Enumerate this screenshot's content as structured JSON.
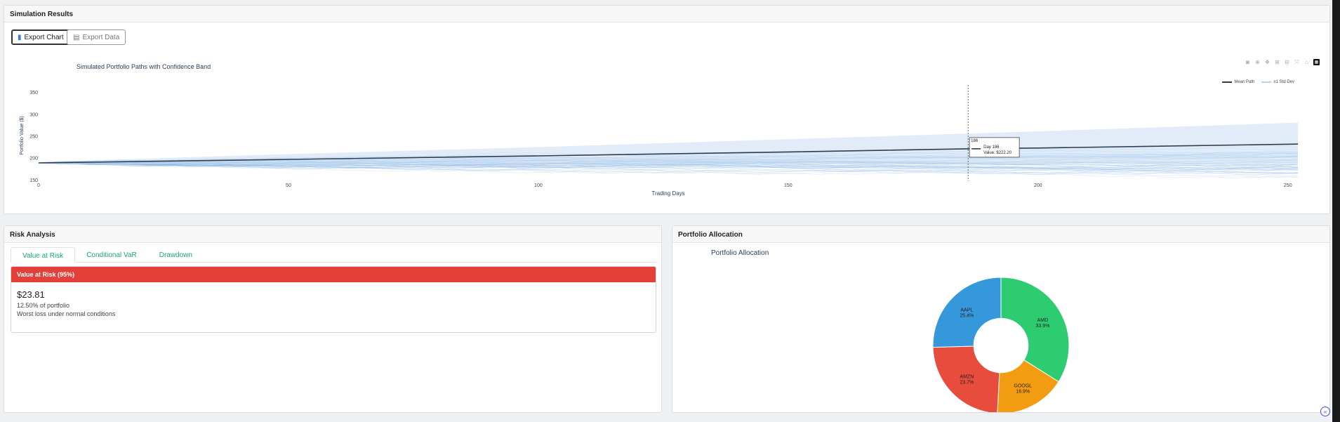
{
  "simulation": {
    "header": "Simulation Results",
    "export_chart_label": "Export Chart",
    "export_data_label": "Export Data",
    "chart_title": "Simulated Portfolio Paths with Confidence Band",
    "legend_mean": "Mean Path",
    "legend_band": "±1 Std Dev",
    "tooltip_header": "186",
    "tooltip_day": "Day 186",
    "tooltip_value": "Value: $222.20",
    "toolbar_icons": [
      "camera-icon",
      "zoom-icon",
      "pan-icon",
      "zoom-in-icon",
      "zoom-out-icon",
      "autoscale-icon",
      "reset-axes-icon",
      "plotly-logo-icon"
    ]
  },
  "chart_data": [
    {
      "type": "line",
      "title": "Simulated Portfolio Paths with Confidence Band",
      "xlabel": "Trading Days",
      "ylabel": "Portfolio Value ($)",
      "xlim": [
        0,
        252
      ],
      "ylim": [
        145,
        360
      ],
      "x_ticks": [
        0,
        50,
        100,
        150,
        200,
        250
      ],
      "y_ticks": [
        150,
        200,
        250,
        300,
        350
      ],
      "x_tick_labels": [
        "0",
        "50",
        "100",
        "150",
        "200",
        "250"
      ],
      "y_tick_labels": [
        "150",
        "200",
        "250",
        "300",
        "350"
      ],
      "series": [
        {
          "name": "Mean Path",
          "x": [
            0,
            50,
            100,
            150,
            186,
            200,
            252
          ],
          "values": [
            190,
            198,
            206,
            215,
            222.2,
            224,
            233
          ]
        },
        {
          "name": "±1 Std Dev",
          "x": [
            0,
            50,
            100,
            150,
            200,
            252
          ],
          "upper": [
            192,
            210,
            226,
            244,
            262,
            282
          ],
          "lower": [
            188,
            186,
            186,
            188,
            188,
            186
          ]
        }
      ],
      "hover": {
        "x": 186,
        "value": 222.2
      },
      "grid": false,
      "legend_position": "top-right",
      "colors": {
        "mean": "#2c3e50",
        "band": "#c9ddf2",
        "paths": "#7fb0e0"
      }
    },
    {
      "type": "pie",
      "title": "Portfolio Allocation",
      "hole": 0.4,
      "labels": [
        "AMD",
        "GOOGL",
        "AMZN",
        "AAPL"
      ],
      "values": [
        33.9,
        16.9,
        23.7,
        25.4
      ],
      "percent_labels": [
        "33.9%",
        "16.9%",
        "23.7%",
        "25.4%"
      ],
      "colors": [
        "#2ecc71",
        "#f39c12",
        "#e74c3c",
        "#3498db"
      ]
    }
  ],
  "risk": {
    "header": "Risk Analysis",
    "tabs": [
      {
        "label": "Value at Risk"
      },
      {
        "label": "Conditional VaR"
      },
      {
        "label": "Drawdown"
      }
    ],
    "var_title": "Value at Risk (95%)",
    "var_value": "$23.81",
    "var_pct": "12.50% of portfolio",
    "var_desc": "Worst loss under normal conditions"
  },
  "allocation": {
    "header": "Portfolio Allocation",
    "chart_title": "Portfolio Allocation"
  }
}
